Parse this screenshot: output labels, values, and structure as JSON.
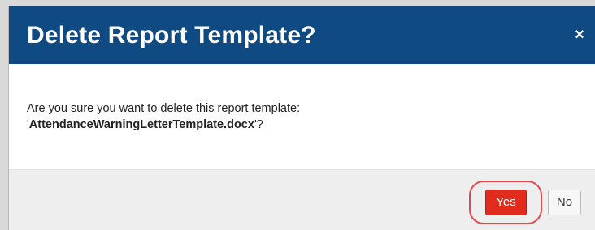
{
  "dialog": {
    "title": "Delete Report Template?",
    "close_icon": "close-icon",
    "close_symbol": "×",
    "message_prefix": "Are you sure you want to delete this report template:",
    "quote_open": "'",
    "filename": "AttendanceWarningLetterTemplate.docx",
    "quote_close": "'?",
    "yes_label": "Yes",
    "no_label": "No"
  },
  "colors": {
    "header": "#0f4a82",
    "yes_button": "#e12b1c",
    "highlight": "#e2494e"
  }
}
